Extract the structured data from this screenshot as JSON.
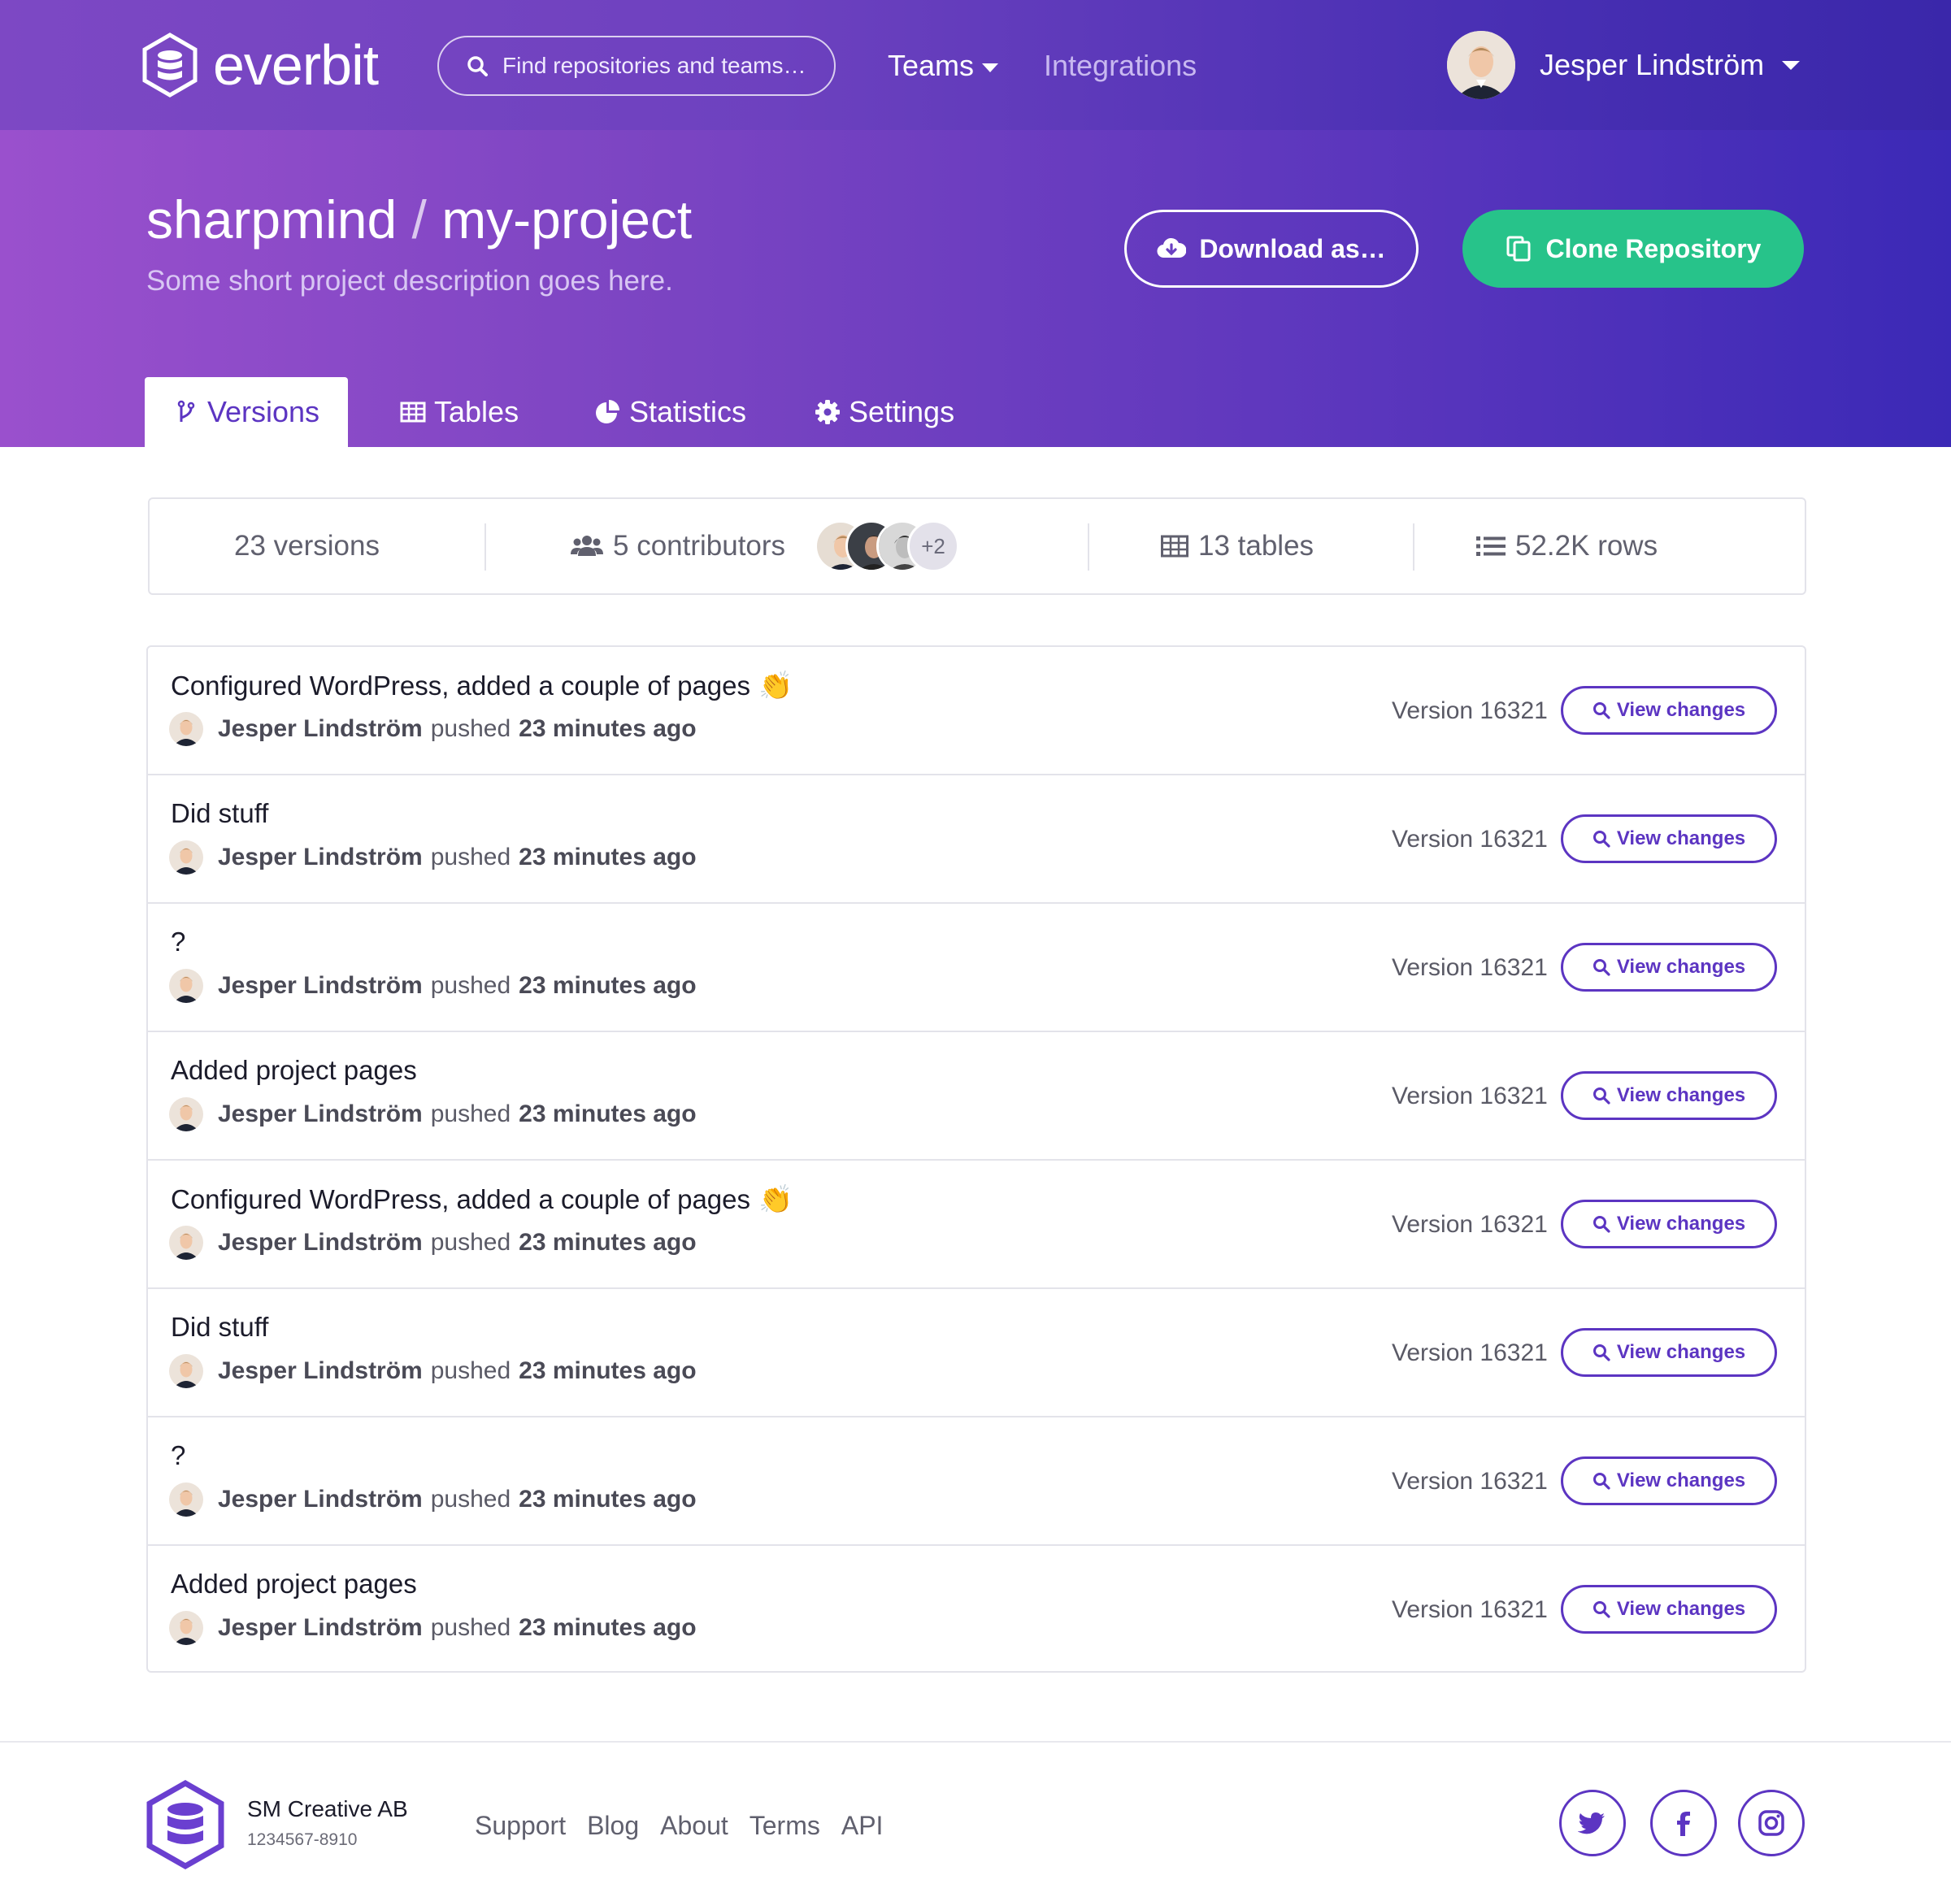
{
  "brand": {
    "name": "everbit",
    "logo_icon": "database-hexagon-icon"
  },
  "search": {
    "placeholder": "Find repositories and teams…"
  },
  "nav": {
    "teams_label": "Teams",
    "integrations_label": "Integrations"
  },
  "user": {
    "name": "Jesper Lindström"
  },
  "project": {
    "owner": "sharpmind",
    "separator": "/",
    "name": "my-project",
    "description": "Some short project description goes here."
  },
  "actions": {
    "download_label": "Download as…",
    "clone_label": "Clone Repository"
  },
  "tabs": [
    {
      "label": "Versions",
      "icon": "branch-icon",
      "active": true
    },
    {
      "label": "Tables",
      "icon": "table-icon",
      "active": false
    },
    {
      "label": "Statistics",
      "icon": "pie-chart-icon",
      "active": false
    },
    {
      "label": "Settings",
      "icon": "gear-icon",
      "active": false
    }
  ],
  "stats": {
    "versions": "23 versions",
    "contributors": "5 contributors",
    "contributors_more": "+2",
    "tables": "13 tables",
    "rows": "52.2K rows"
  },
  "versions": [
    {
      "message": "Configured WordPress, added a couple of pages",
      "emoji": "👏",
      "author": "Jesper Lindström",
      "verb": "pushed",
      "time": "23 minutes ago",
      "version": "Version 16321",
      "button": "View changes"
    },
    {
      "message": "Did stuff",
      "emoji": "",
      "author": "Jesper Lindström",
      "verb": "pushed",
      "time": "23 minutes ago",
      "version": "Version 16321",
      "button": "View changes"
    },
    {
      "message": "?",
      "emoji": "",
      "author": "Jesper Lindström",
      "verb": "pushed",
      "time": "23 minutes ago",
      "version": "Version 16321",
      "button": "View changes"
    },
    {
      "message": "Added project pages",
      "emoji": "",
      "author": "Jesper Lindström",
      "verb": "pushed",
      "time": "23 minutes ago",
      "version": "Version 16321",
      "button": "View changes"
    },
    {
      "message": "Configured WordPress, added a couple of pages",
      "emoji": "👏",
      "author": "Jesper Lindström",
      "verb": "pushed",
      "time": "23 minutes ago",
      "version": "Version 16321",
      "button": "View changes"
    },
    {
      "message": "Did stuff",
      "emoji": "",
      "author": "Jesper Lindström",
      "verb": "pushed",
      "time": "23 minutes ago",
      "version": "Version 16321",
      "button": "View changes"
    },
    {
      "message": "?",
      "emoji": "",
      "author": "Jesper Lindström",
      "verb": "pushed",
      "time": "23 minutes ago",
      "version": "Version 16321",
      "button": "View changes"
    },
    {
      "message": "Added project pages",
      "emoji": "",
      "author": "Jesper Lindström",
      "verb": "pushed",
      "time": "23 minutes ago",
      "version": "Version 16321",
      "button": "View changes"
    }
  ],
  "footer": {
    "company": "SM Creative AB",
    "org_number": "1234567-8910",
    "links": [
      "Support",
      "Blog",
      "About",
      "Terms",
      "API"
    ],
    "social": [
      "twitter-icon",
      "facebook-icon",
      "instagram-icon"
    ]
  },
  "colors": {
    "accent": "#5c35c2",
    "clone_green": "#27c38a",
    "hero_start": "#9a50cd",
    "hero_end": "#3b29b6"
  }
}
